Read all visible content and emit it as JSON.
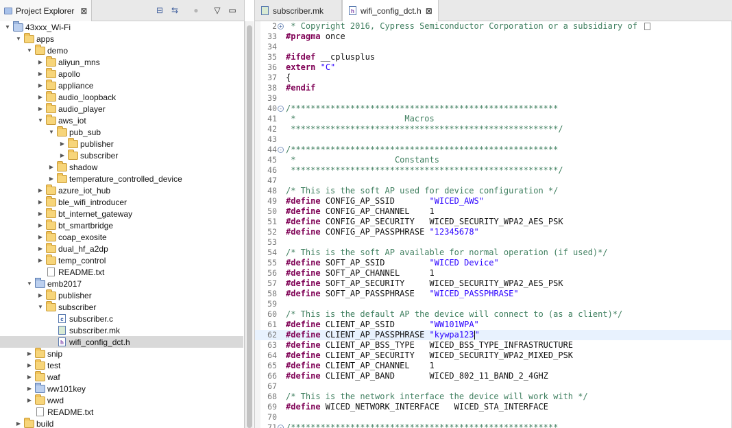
{
  "explorer": {
    "tab_title": "Project Explorer",
    "close_glyph": "⊠",
    "tools": [
      {
        "name": "collapse-all-icon",
        "glyph": "⊟"
      },
      {
        "name": "link-with-editor-icon",
        "glyph": "⇆"
      },
      {
        "name": "focus-icon",
        "glyph": "●"
      },
      {
        "name": "view-menu-icon",
        "glyph": "▽"
      },
      {
        "name": "minimize-icon",
        "glyph": "▭"
      },
      {
        "name": "maximize-icon",
        "glyph": "▣"
      }
    ],
    "tree": [
      {
        "label": "43xxx_Wi-Fi",
        "depth": 0,
        "expanded": true,
        "icon": "project"
      },
      {
        "label": "apps",
        "depth": 1,
        "expanded": true,
        "icon": "folder"
      },
      {
        "label": "demo",
        "depth": 2,
        "expanded": true,
        "icon": "folder"
      },
      {
        "label": "aliyun_mns",
        "depth": 3,
        "expanded": false,
        "icon": "folder"
      },
      {
        "label": "apollo",
        "depth": 3,
        "expanded": false,
        "icon": "folder"
      },
      {
        "label": "appliance",
        "depth": 3,
        "expanded": false,
        "icon": "folder"
      },
      {
        "label": "audio_loopback",
        "depth": 3,
        "expanded": false,
        "icon": "folder"
      },
      {
        "label": "audio_player",
        "depth": 3,
        "expanded": false,
        "icon": "folder"
      },
      {
        "label": "aws_iot",
        "depth": 3,
        "expanded": true,
        "icon": "folder"
      },
      {
        "label": "pub_sub",
        "depth": 4,
        "expanded": true,
        "icon": "folder"
      },
      {
        "label": "publisher",
        "depth": 5,
        "expanded": false,
        "icon": "folder"
      },
      {
        "label": "subscriber",
        "depth": 5,
        "expanded": false,
        "icon": "folder"
      },
      {
        "label": "shadow",
        "depth": 4,
        "expanded": false,
        "icon": "folder"
      },
      {
        "label": "temperature_controlled_device",
        "depth": 4,
        "expanded": false,
        "icon": "folder"
      },
      {
        "label": "azure_iot_hub",
        "depth": 3,
        "expanded": false,
        "icon": "folder"
      },
      {
        "label": "ble_wifi_introducer",
        "depth": 3,
        "expanded": false,
        "icon": "folder"
      },
      {
        "label": "bt_internet_gateway",
        "depth": 3,
        "expanded": false,
        "icon": "folder"
      },
      {
        "label": "bt_smartbridge",
        "depth": 3,
        "expanded": false,
        "icon": "folder"
      },
      {
        "label": "coap_exosite",
        "depth": 3,
        "expanded": false,
        "icon": "folder"
      },
      {
        "label": "dual_hf_a2dp",
        "depth": 3,
        "expanded": false,
        "icon": "folder"
      },
      {
        "label": "temp_control",
        "depth": 3,
        "expanded": false,
        "icon": "folder"
      },
      {
        "label": "README.txt",
        "depth": 3,
        "expanded": null,
        "icon": "file"
      },
      {
        "label": "emb2017",
        "depth": 2,
        "expanded": true,
        "icon": "project"
      },
      {
        "label": "publisher",
        "depth": 3,
        "expanded": false,
        "icon": "folder"
      },
      {
        "label": "subscriber",
        "depth": 3,
        "expanded": true,
        "icon": "folder"
      },
      {
        "label": "subscriber.c",
        "depth": 4,
        "expanded": null,
        "icon": "cfile"
      },
      {
        "label": "subscriber.mk",
        "depth": 4,
        "expanded": null,
        "icon": "mkfile"
      },
      {
        "label": "wifi_config_dct.h",
        "depth": 4,
        "expanded": null,
        "icon": "hfile",
        "selected": true
      },
      {
        "label": "snip",
        "depth": 2,
        "expanded": false,
        "icon": "folder"
      },
      {
        "label": "test",
        "depth": 2,
        "expanded": false,
        "icon": "folder"
      },
      {
        "label": "waf",
        "depth": 2,
        "expanded": false,
        "icon": "folder"
      },
      {
        "label": "ww101key",
        "depth": 2,
        "expanded": false,
        "icon": "project"
      },
      {
        "label": "wwd",
        "depth": 2,
        "expanded": false,
        "icon": "folder"
      },
      {
        "label": "README.txt",
        "depth": 2,
        "expanded": null,
        "icon": "file"
      },
      {
        "label": "build",
        "depth": 1,
        "expanded": false,
        "icon": "folder"
      }
    ]
  },
  "editor": {
    "tabs": [
      {
        "label": "subscriber.mk",
        "icon": "mk",
        "active": false
      },
      {
        "label": "wifi_config_dct.h",
        "icon": "h",
        "active": true,
        "close_glyph": "⊠"
      }
    ],
    "current_line": "62",
    "lines": [
      {
        "n": "2",
        "fold": "+",
        "parts": [
          {
            "t": " * Copyright 2016, Cypress Semiconductor Corporation or a subsidiary of ",
            "c": "cmt"
          }
        ],
        "expand_box": true
      },
      {
        "n": "33",
        "parts": [
          {
            "t": "#pragma",
            "c": "kw"
          },
          {
            "t": " once",
            "c": ""
          }
        ]
      },
      {
        "n": "34",
        "parts": []
      },
      {
        "n": "35",
        "parts": [
          {
            "t": "#ifdef",
            "c": "kw"
          },
          {
            "t": " __cplusplus",
            "c": ""
          }
        ]
      },
      {
        "n": "36",
        "parts": [
          {
            "t": "extern",
            "c": "kw"
          },
          {
            "t": " ",
            "c": ""
          },
          {
            "t": "\"C\"",
            "c": "str"
          }
        ]
      },
      {
        "n": "37",
        "parts": [
          {
            "t": "{",
            "c": ""
          }
        ]
      },
      {
        "n": "38",
        "parts": [
          {
            "t": "#endif",
            "c": "kw"
          }
        ]
      },
      {
        "n": "39",
        "parts": []
      },
      {
        "n": "40",
        "fold": "-",
        "parts": [
          {
            "t": "/******************************************************",
            "c": "cmt"
          }
        ]
      },
      {
        "n": "41",
        "parts": [
          {
            "t": " *                      Macros",
            "c": "cmt"
          }
        ]
      },
      {
        "n": "42",
        "parts": [
          {
            "t": " ******************************************************/",
            "c": "cmt"
          }
        ]
      },
      {
        "n": "43",
        "parts": []
      },
      {
        "n": "44",
        "fold": "-",
        "parts": [
          {
            "t": "/******************************************************",
            "c": "cmt"
          }
        ]
      },
      {
        "n": "45",
        "parts": [
          {
            "t": " *                    Constants",
            "c": "cmt"
          }
        ]
      },
      {
        "n": "46",
        "parts": [
          {
            "t": " ******************************************************/",
            "c": "cmt"
          }
        ]
      },
      {
        "n": "47",
        "parts": []
      },
      {
        "n": "48",
        "parts": [
          {
            "t": "/* This is the soft AP used for device configuration */",
            "c": "cmt"
          }
        ]
      },
      {
        "n": "49",
        "parts": [
          {
            "t": "#define",
            "c": "kw"
          },
          {
            "t": " CONFIG_AP_SSID       ",
            "c": ""
          },
          {
            "t": "\"WICED_AWS\"",
            "c": "str"
          }
        ]
      },
      {
        "n": "50",
        "parts": [
          {
            "t": "#define",
            "c": "kw"
          },
          {
            "t": " CONFIG_AP_CHANNEL    1",
            "c": ""
          }
        ]
      },
      {
        "n": "51",
        "parts": [
          {
            "t": "#define",
            "c": "kw"
          },
          {
            "t": " CONFIG_AP_SECURITY   WICED_SECURITY_WPA2_AES_PSK",
            "c": ""
          }
        ]
      },
      {
        "n": "52",
        "parts": [
          {
            "t": "#define",
            "c": "kw"
          },
          {
            "t": " CONFIG_AP_PASSPHRASE ",
            "c": ""
          },
          {
            "t": "\"12345678\"",
            "c": "str"
          }
        ]
      },
      {
        "n": "53",
        "parts": []
      },
      {
        "n": "54",
        "parts": [
          {
            "t": "/* This is the soft AP available for normal operation (if used)*/",
            "c": "cmt"
          }
        ]
      },
      {
        "n": "55",
        "parts": [
          {
            "t": "#define",
            "c": "kw"
          },
          {
            "t": " SOFT_AP_SSID         ",
            "c": ""
          },
          {
            "t": "\"WICED Device\"",
            "c": "str"
          }
        ]
      },
      {
        "n": "56",
        "parts": [
          {
            "t": "#define",
            "c": "kw"
          },
          {
            "t": " SOFT_AP_CHANNEL      1",
            "c": ""
          }
        ]
      },
      {
        "n": "57",
        "parts": [
          {
            "t": "#define",
            "c": "kw"
          },
          {
            "t": " SOFT_AP_SECURITY     WICED_SECURITY_WPA2_AES_PSK",
            "c": ""
          }
        ]
      },
      {
        "n": "58",
        "parts": [
          {
            "t": "#define",
            "c": "kw"
          },
          {
            "t": " SOFT_AP_PASSPHRASE   ",
            "c": ""
          },
          {
            "t": "\"WICED_PASSPHRASE\"",
            "c": "str"
          }
        ]
      },
      {
        "n": "59",
        "parts": []
      },
      {
        "n": "60",
        "parts": [
          {
            "t": "/* This is the default AP the device will connect to (as a client)*/",
            "c": "cmt"
          }
        ]
      },
      {
        "n": "61",
        "parts": [
          {
            "t": "#define",
            "c": "kw"
          },
          {
            "t": " CLIENT_AP_SSID       ",
            "c": ""
          },
          {
            "t": "\"WW101WPA\"",
            "c": "str"
          }
        ]
      },
      {
        "n": "62",
        "parts": [
          {
            "t": "#define",
            "c": "kw"
          },
          {
            "t": " CLIENT_AP_PASSPHRASE ",
            "c": ""
          },
          {
            "t": "\"kywpa123",
            "c": "str"
          },
          {
            "t": "|",
            "c": "caret"
          },
          {
            "t": "\"",
            "c": "str"
          }
        ]
      },
      {
        "n": "63",
        "parts": [
          {
            "t": "#define",
            "c": "kw"
          },
          {
            "t": " CLIENT_AP_BSS_TYPE   WICED_BSS_TYPE_INFRASTRUCTURE",
            "c": ""
          }
        ]
      },
      {
        "n": "64",
        "parts": [
          {
            "t": "#define",
            "c": "kw"
          },
          {
            "t": " CLIENT_AP_SECURITY   WICED_SECURITY_WPA2_MIXED_PSK",
            "c": ""
          }
        ]
      },
      {
        "n": "65",
        "parts": [
          {
            "t": "#define",
            "c": "kw"
          },
          {
            "t": " CLIENT_AP_CHANNEL    1",
            "c": ""
          }
        ]
      },
      {
        "n": "66",
        "parts": [
          {
            "t": "#define",
            "c": "kw"
          },
          {
            "t": " CLIENT_AP_BAND       WICED_802_11_BAND_2_4GHZ",
            "c": ""
          }
        ]
      },
      {
        "n": "67",
        "parts": []
      },
      {
        "n": "68",
        "parts": [
          {
            "t": "/* This is the network interface the device will work with */",
            "c": "cmt"
          }
        ]
      },
      {
        "n": "69",
        "parts": [
          {
            "t": "#define",
            "c": "kw"
          },
          {
            "t": " WICED_NETWORK_INTERFACE   WICED_STA_INTERFACE",
            "c": ""
          }
        ]
      },
      {
        "n": "70",
        "parts": []
      },
      {
        "n": "71",
        "fold": "-",
        "parts": [
          {
            "t": "/******************************************************",
            "c": "cmt"
          }
        ]
      }
    ]
  }
}
